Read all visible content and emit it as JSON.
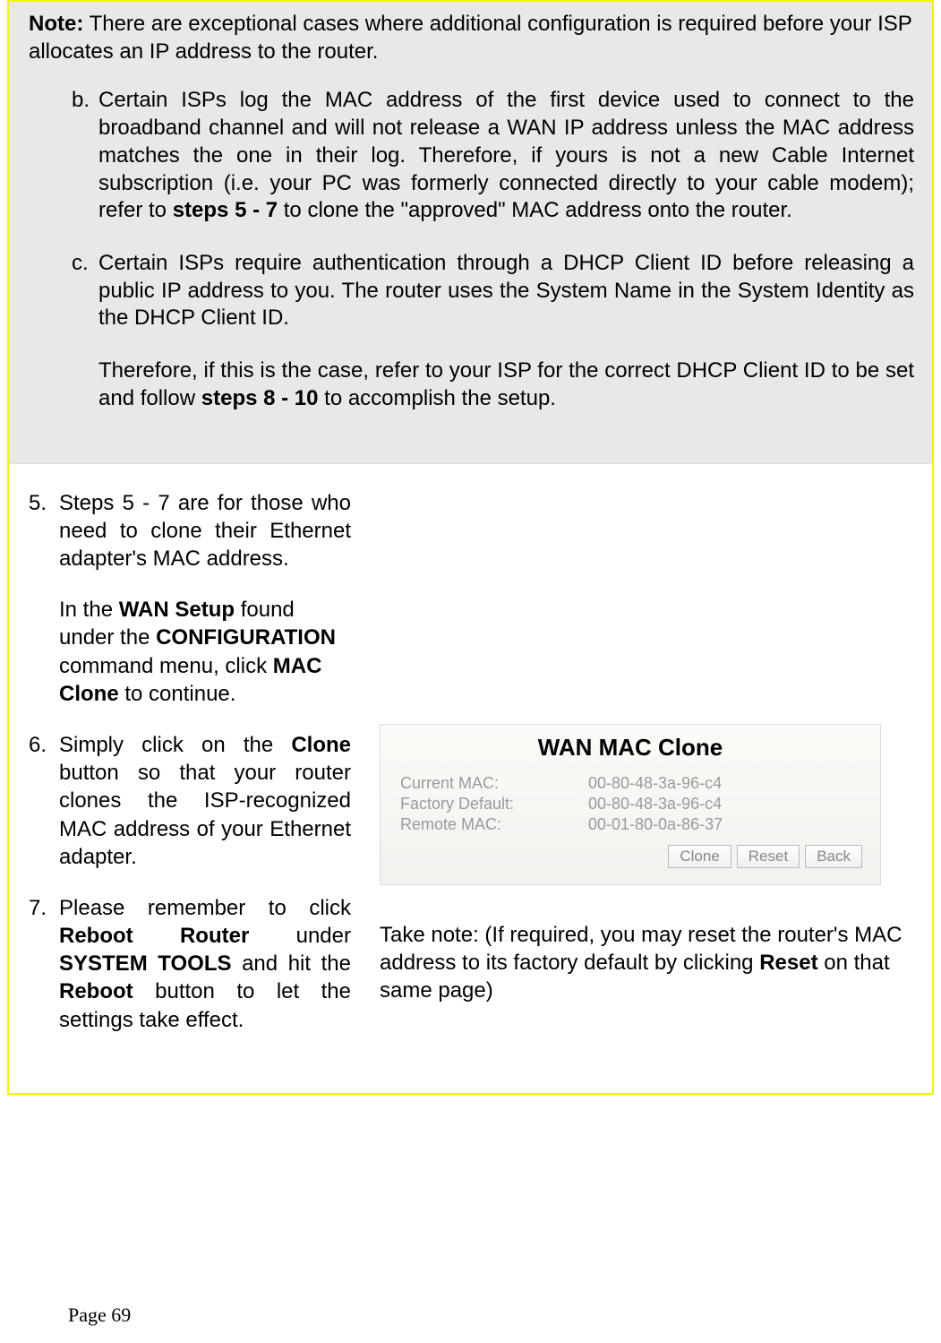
{
  "note": {
    "intro_prefix": "Note:",
    "intro_text": " There are exceptional cases where additional configuration is required before your ISP allocates an IP address to the router.",
    "items": {
      "b": {
        "marker": "b.",
        "prefix": "Certain ISPs log the MAC address of the first device used to connect to the broadband channel and will not release a WAN IP address unless the MAC address matches the one in their log. Therefore, if yours is not a new Cable Internet subscription (i.e. your PC was formerly connected directly to your cable modem); refer to ",
        "bold": "steps 5 - 7",
        "suffix": " to clone the \"approved\" MAC address onto the router."
      },
      "c": {
        "marker": "c.",
        "p1": "Certain ISPs require authentication through a DHCP Client ID before releasing a public IP address to you. The router uses the System Name in the System Identity as the DHCP Client ID.",
        "p2_prefix": "Therefore, if this is the case, refer to your ISP for the correct DHCP Client ID to be set and follow ",
        "p2_bold": "steps 8 - 10",
        "p2_suffix": " to accomplish the setup."
      }
    }
  },
  "steps": {
    "s5": {
      "num": "5.",
      "p1": "Steps 5 - 7 are for those who need to clone their Ethernet adapter's MAC address.",
      "p2_a": "In the ",
      "p2_b": "WAN Setup",
      "p2_c": " found under the ",
      "p2_d": "CONFIGURATION",
      "p2_e": " command menu, click ",
      "p2_f": "MAC Clone",
      "p2_g": " to continue."
    },
    "s6": {
      "num": "6.",
      "a": "Simply click on the ",
      "b": "Clone",
      "c": " button so that your router clones the ISP-recognized MAC address of your Ethernet adapter."
    },
    "s7": {
      "num": "7.",
      "a": "Please remember to click ",
      "b": "Reboot Router",
      "c": " under ",
      "d": "SYSTEM TOOLS",
      "e": " and hit the ",
      "f": "Reboot",
      "g": " button to let the settings take effect."
    }
  },
  "panel": {
    "title": "WAN MAC Clone",
    "rows": {
      "current_label": "Current MAC:",
      "current_value": "00-80-48-3a-96-c4",
      "factory_label": "Factory Default:",
      "factory_value": "00-80-48-3a-96-c4",
      "remote_label": "Remote MAC:",
      "remote_value": "00-01-80-0a-86-37"
    },
    "buttons": {
      "clone": "Clone",
      "reset": "Reset",
      "back": "Back"
    }
  },
  "take_note": {
    "a": "Take note: (If required, you may reset the router's MAC address to its factory default by clicking ",
    "b": "Reset",
    "c": " on that same page)"
  },
  "page_number": "Page 69"
}
